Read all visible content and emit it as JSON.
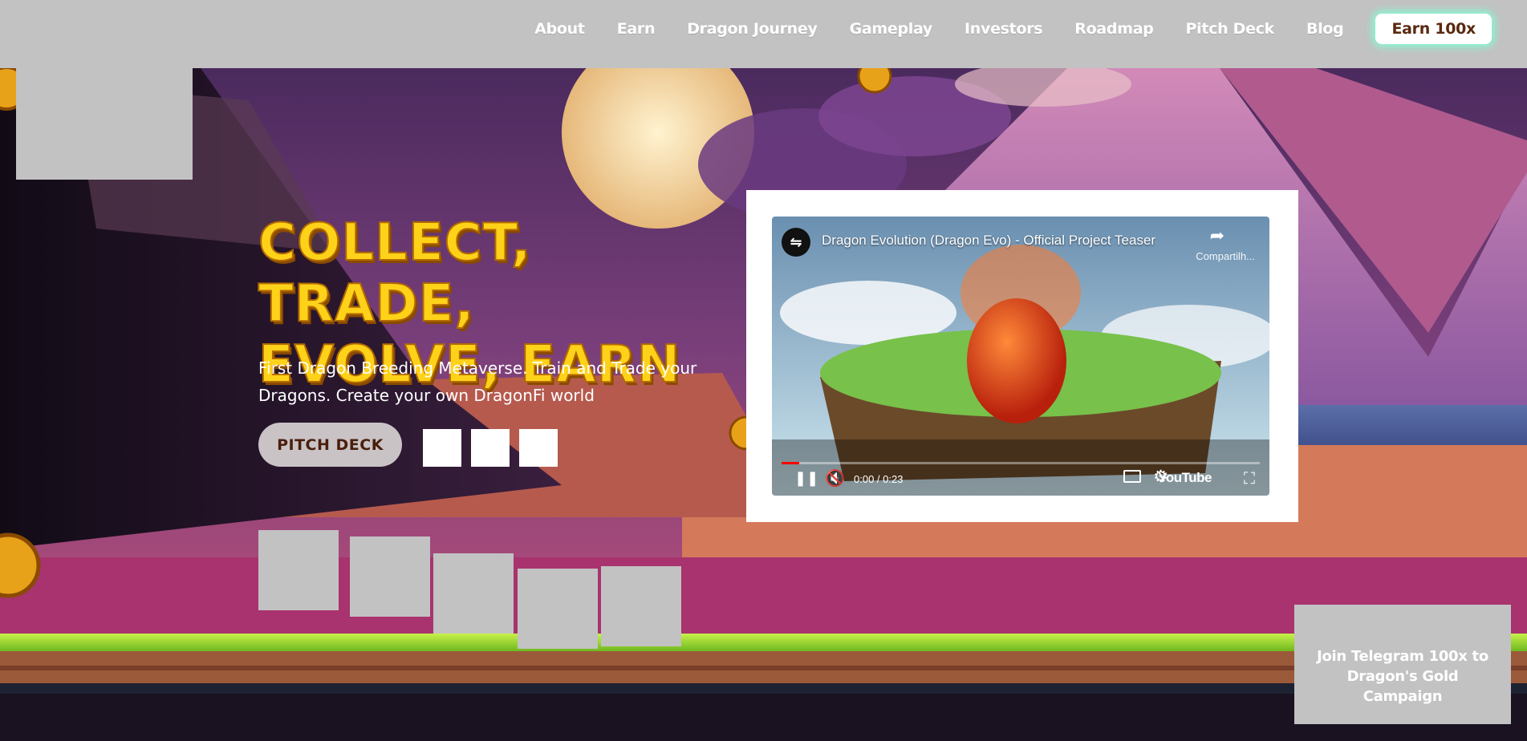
{
  "nav": {
    "links": [
      "About",
      "Earn",
      "Dragon Journey",
      "Gameplay",
      "Investors",
      "Roadmap",
      "Pitch Deck",
      "Blog"
    ],
    "cta_label": "Earn 100x"
  },
  "hero": {
    "headline": "COLLECT, TRADE, EVOLVE, EARN",
    "subtitle": "First Dragon Breeding Metaverse. Train and Trade your Dragons. Create your own DragonFi world",
    "pitch_button": "PITCH DECK"
  },
  "video": {
    "title": "Dragon Evolution (Dragon Evo) - Official Project Teaser",
    "share_label": "Compartilh...",
    "time": "0:00 / 0:23",
    "platform": "YouTube"
  },
  "telegram": {
    "label": "Join Telegram 100x to Dragon's Gold Campaign"
  },
  "colors": {
    "nav_bg": "#c2c2c2",
    "headline": "#ffd21a",
    "cta_glow": "#7fffd4",
    "pitch_btn_text": "#4a1f0c"
  }
}
